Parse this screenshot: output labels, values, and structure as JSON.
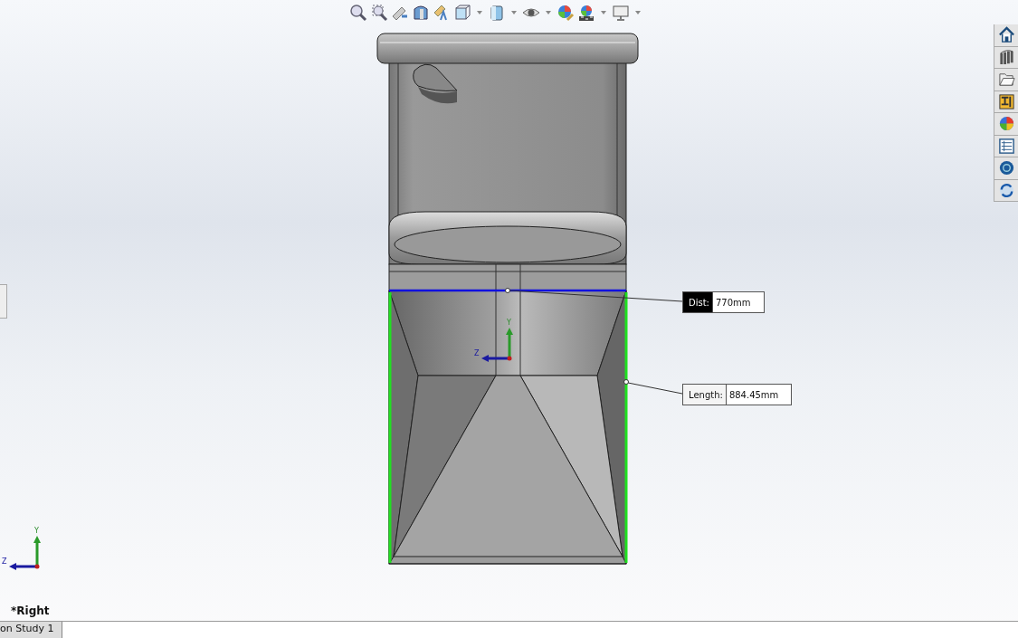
{
  "callouts": [
    {
      "label": "Dist:",
      "value": "770mm",
      "selected": true
    },
    {
      "label": "Length:",
      "value": "884.45mm",
      "selected": false
    }
  ],
  "triads": [
    {
      "y_label": "Y",
      "z_label": "Z"
    },
    {
      "y_label": "Y",
      "z_label": "Z"
    }
  ],
  "view_name": "*Right",
  "bottom_tabs": [
    {
      "label": "on Study 1",
      "selected": true
    }
  ]
}
